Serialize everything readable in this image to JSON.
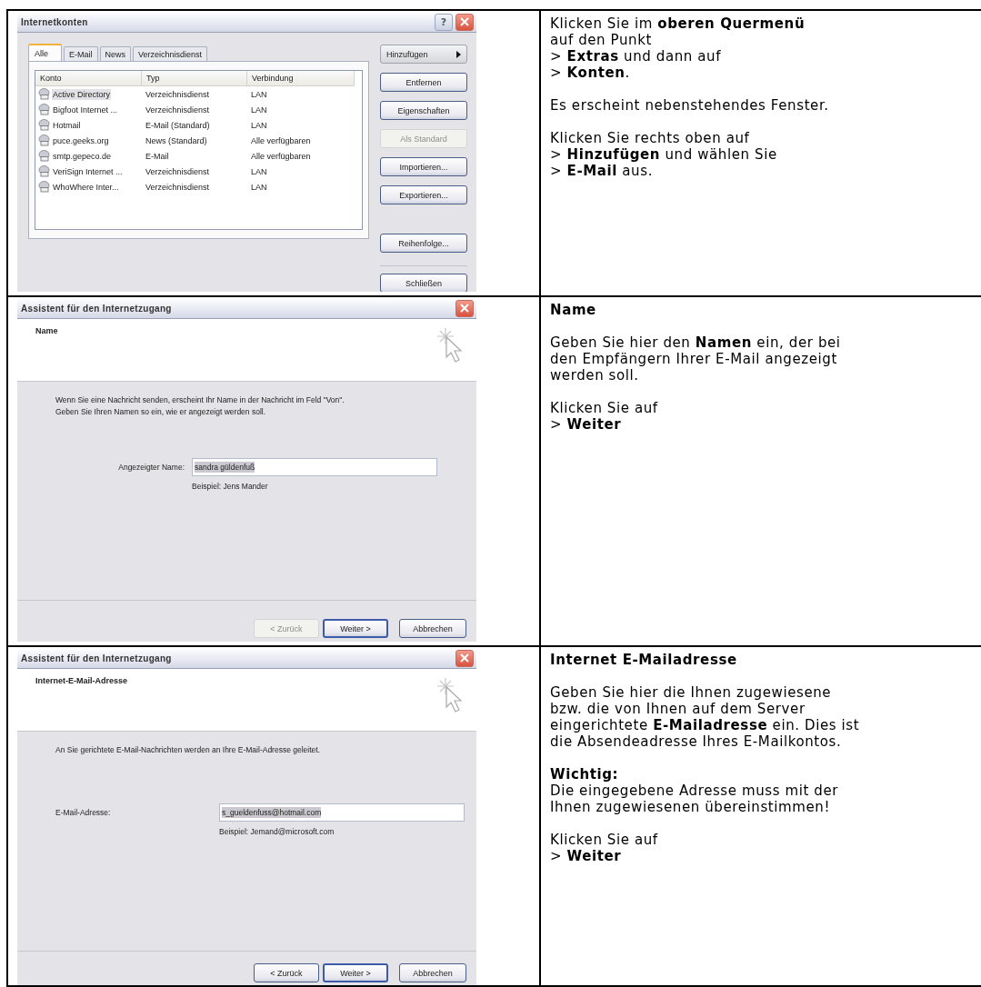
{
  "steps": [
    {
      "kind": "accounts",
      "dialog": {
        "title": "Internetkonten",
        "help": "?",
        "tabs": [
          {
            "label": "Alle",
            "selected": true
          },
          {
            "label": "E-Mail",
            "selected": false
          },
          {
            "label": "News",
            "selected": false
          },
          {
            "label": "Verzeichnisdienst",
            "selected": false
          }
        ],
        "columns": [
          "Konto",
          "Typ",
          "Verbindung"
        ],
        "rows": [
          {
            "cells": [
              "Active Directory",
              "Verzeichnisdienst",
              "LAN"
            ],
            "selected": true
          },
          {
            "cells": [
              "Bigfoot Internet ...",
              "Verzeichnisdienst",
              "LAN"
            ],
            "selected": false
          },
          {
            "cells": [
              "Hotmail",
              "E-Mail (Standard)",
              "LAN"
            ],
            "selected": false
          },
          {
            "cells": [
              "puce.geeks.org",
              "News (Standard)",
              "Alle verfügbaren"
            ],
            "selected": false
          },
          {
            "cells": [
              "smtp.gepeco.de",
              "E-Mail",
              "Alle verfügbaren"
            ],
            "selected": false
          },
          {
            "cells": [
              "VeriSign Internet ...",
              "Verzeichnisdienst",
              "LAN"
            ],
            "selected": false
          },
          {
            "cells": [
              "WhoWhere Inter...",
              "Verzeichnisdienst",
              "LAN"
            ],
            "selected": false
          }
        ],
        "buttons": [
          {
            "label": "Hinzufügen",
            "kind": "menu",
            "disabled": false
          },
          {
            "label": "Entfernen",
            "kind": "plain",
            "disabled": false
          },
          {
            "label": "Eigenschaften",
            "kind": "plain",
            "disabled": false
          },
          {
            "label": "Als Standard",
            "kind": "plain",
            "disabled": true
          },
          {
            "label": "Importieren...",
            "kind": "plain",
            "disabled": false
          },
          {
            "label": "Exportieren...",
            "kind": "plain",
            "disabled": false
          },
          {
            "label": "Reihenfolge...",
            "kind": "spaced",
            "disabled": false
          },
          {
            "label": "Schließen",
            "kind": "footer",
            "disabled": false
          }
        ]
      },
      "text": [
        {
          "kind": "text",
          "lines": [
            "Klicken Sie im **oberen Quermenü**",
            "auf den Punkt",
            "> **Extras** und dann auf",
            "> **Konten**."
          ]
        },
        {
          "kind": "text",
          "lines": [
            "Es erscheint nebenstehendes Fenster."
          ]
        },
        {
          "kind": "text",
          "lines": [
            "Klicken Sie rechts oben auf",
            "> **Hinzufügen** und wählen Sie",
            "> **E-Mail** aus."
          ]
        }
      ]
    },
    {
      "kind": "wizard",
      "dialog": {
        "title": "Assistent für den Internetzugang",
        "heading": "Name",
        "description": [
          "Wenn Sie eine Nachricht senden, erscheint Ihr Name in der Nachricht im Feld \"Von\".",
          "Geben Sie Ihren Namen so ein, wie er angezeigt werden soll."
        ],
        "field_label": "Angezeigter Name:",
        "value": "sandra güldenfuß",
        "value_selected": true,
        "example": "Beispiel: Jens Mander",
        "buttons": [
          {
            "label": "< Zurück",
            "disabled": true,
            "default": false
          },
          {
            "label": "Weiter >",
            "disabled": false,
            "default": true
          },
          {
            "label": "Abbrechen",
            "disabled": false,
            "default": false
          }
        ]
      },
      "text": [
        {
          "kind": "heading",
          "lines": [
            "Name"
          ]
        },
        {
          "kind": "text",
          "lines": [
            "Geben Sie hier den **Namen** ein, der bei",
            "den Empfängern Ihrer E-Mail angezeigt",
            "werden soll."
          ]
        },
        {
          "kind": "text",
          "lines": [
            "Klicken Sie auf",
            "> **Weiter**"
          ]
        }
      ]
    },
    {
      "kind": "wizard",
      "dialog": {
        "title": "Assistent für den Internetzugang",
        "heading": "Internet-E-Mail-Adresse",
        "description": [
          "An Sie gerichtete E-Mail-Nachrichten werden an Ihre E-Mail-Adresse geleitet."
        ],
        "field_label": "E-Mail-Adresse:",
        "value": "s_gueldenfuss@hotmail.com",
        "value_selected": true,
        "example": "Beispiel: Jemand@microsoft.com",
        "buttons": [
          {
            "label": "< Zurück",
            "disabled": false,
            "default": false
          },
          {
            "label": "Weiter >",
            "disabled": false,
            "default": true
          },
          {
            "label": "Abbrechen",
            "disabled": false,
            "default": false
          }
        ]
      },
      "text": [
        {
          "kind": "heading",
          "lines": [
            "Internet E-Mailadresse"
          ]
        },
        {
          "kind": "text",
          "lines": [
            "Geben Sie hier die Ihnen zugewiesene",
            "bzw. die von Ihnen auf dem Server",
            "eingerichtete **E-Mailadresse** ein. Dies ist",
            "die Absendeadresse Ihres E-Mailkontos."
          ]
        },
        {
          "kind": "text",
          "lines": [
            "**Wichtig:**",
            "Die eingegebene Adresse muss mit der",
            "Ihnen zugewiesenen übereinstimmen!"
          ]
        },
        {
          "kind": "text",
          "lines": [
            "Klicken Sie auf",
            "> **Weiter**"
          ]
        }
      ]
    }
  ]
}
